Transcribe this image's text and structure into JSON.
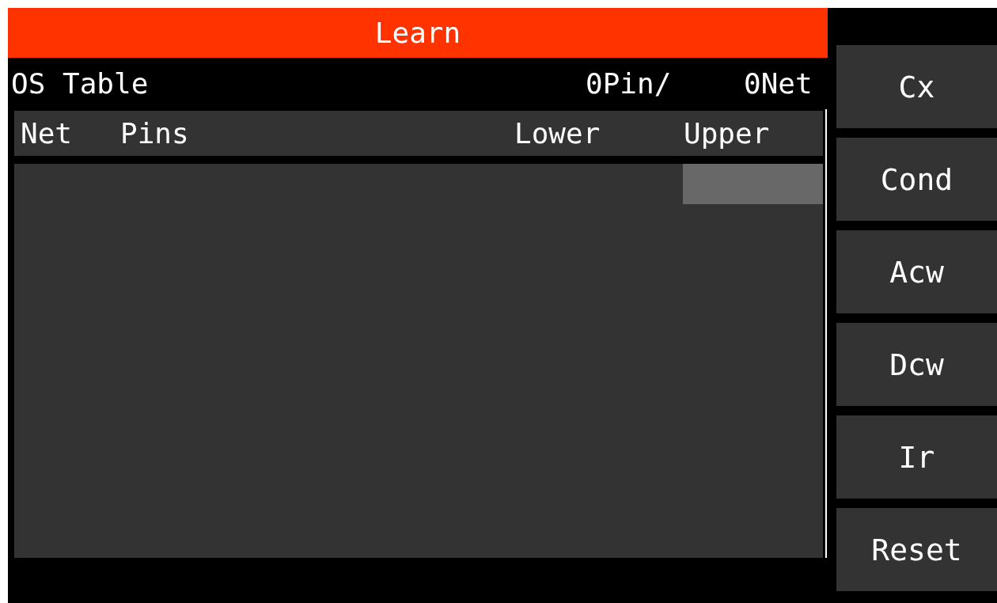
{
  "header": {
    "title": "Learn"
  },
  "info": {
    "title": "OS Table",
    "pin_count": "0Pin/",
    "net_count": "0Net"
  },
  "table": {
    "columns": [
      {
        "label": "Net",
        "selected": false
      },
      {
        "label": "Pins",
        "selected": false
      },
      {
        "label": "Lower",
        "selected": false
      },
      {
        "label": "Upper",
        "selected": true
      }
    ]
  },
  "buttons": [
    "Cx",
    "Cond",
    "Acw",
    "Dcw",
    "Ir",
    "Reset"
  ]
}
